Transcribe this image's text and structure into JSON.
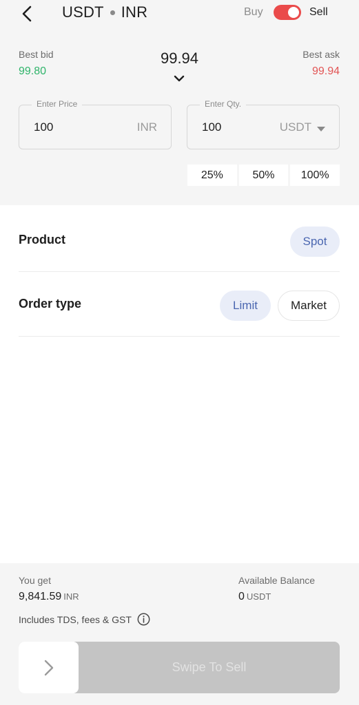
{
  "header": {
    "base": "USDT",
    "quote": "INR",
    "buy_label": "Buy",
    "sell_label": "Sell",
    "mode": "Sell",
    "toggle_color": "#ea4b4b"
  },
  "prices": {
    "best_bid_label": "Best bid",
    "best_bid": "99.80",
    "best_bid_color": "#2fb46a",
    "last_price": "99.94",
    "best_ask_label": "Best ask",
    "best_ask": "99.94",
    "best_ask_color": "#e25555"
  },
  "order_form": {
    "price": {
      "legend": "Enter Price",
      "value": "100",
      "unit": "INR"
    },
    "qty": {
      "legend": "Enter Qty.",
      "value": "100",
      "unit": "USDT"
    },
    "percent_options": [
      "25%",
      "50%",
      "100%"
    ]
  },
  "product": {
    "label": "Product",
    "options": [
      {
        "label": "Spot",
        "selected": true
      }
    ]
  },
  "order_type": {
    "label": "Order type",
    "options": [
      {
        "label": "Limit",
        "selected": true
      },
      {
        "label": "Market",
        "selected": false
      }
    ]
  },
  "summary": {
    "you_get_label": "You get",
    "you_get_value": "9,841.59",
    "you_get_unit": "INR",
    "balance_label": "Available Balance",
    "balance_value": "0",
    "balance_unit": "USDT",
    "note": "Includes TDS, fees & GST"
  },
  "action": {
    "swipe_label": "Swipe To Sell"
  },
  "icons": [
    "back-arrow-icon",
    "chevron-down-icon",
    "caret-down-icon",
    "info-icon",
    "chevron-right-icon"
  ],
  "accent_color": "#4a66b0"
}
